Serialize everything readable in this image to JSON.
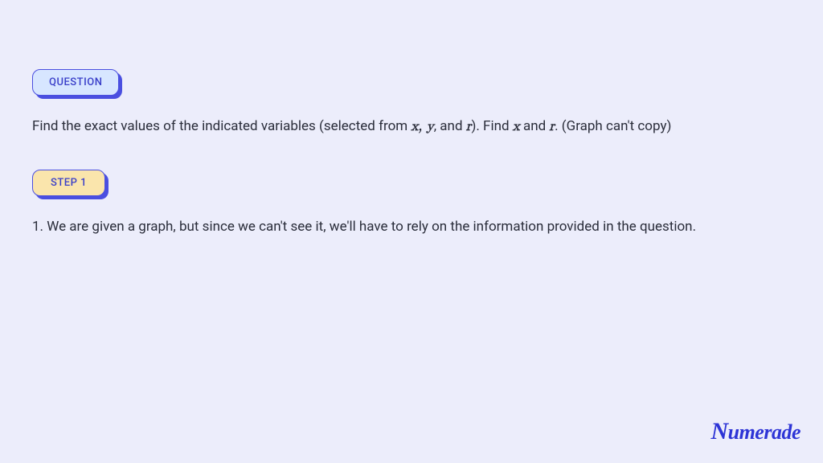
{
  "badges": {
    "question": "QUESTION",
    "step1": "STEP 1"
  },
  "question": {
    "prefix": "Find the exact values of the indicated variables (selected from ",
    "var_list": "x, y",
    "mid1": ", and ",
    "var_r1": "r",
    "mid2": "). Find ",
    "var_x": "x",
    "mid3": " and ",
    "var_r2": "r",
    "suffix": ". (Graph can't copy)"
  },
  "step1_text": "1. We are given a graph, but since we can't see it, we'll have to rely on the information provided in the question.",
  "brand": "Numerade"
}
